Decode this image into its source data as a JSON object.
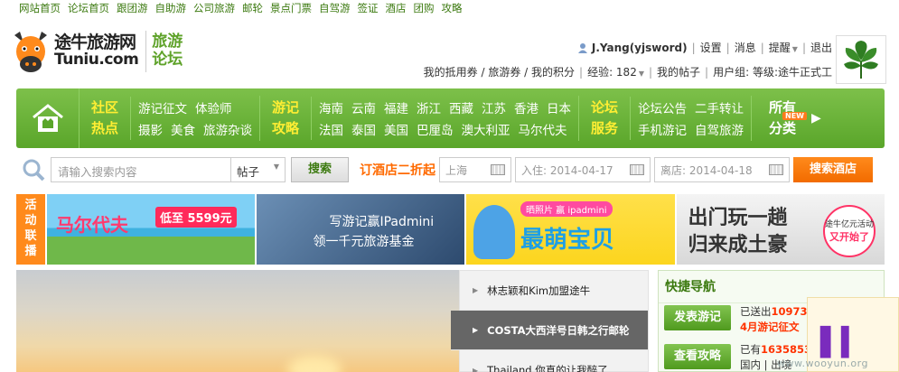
{
  "top_links": [
    "网站首页",
    "论坛首页",
    "跟团游",
    "自助游",
    "公司旅游",
    "邮轮",
    "景点门票",
    "自驾游",
    "签证",
    "酒店",
    "团购",
    "攻略"
  ],
  "logo": {
    "cn": "途牛旅游网",
    "en": "Tuniu.com",
    "forum_line1": "旅游",
    "forum_line2": "论坛"
  },
  "user": {
    "name": "J.Yang(yjsword)",
    "settings": "设置",
    "messages": "消息",
    "reminders": "提醒",
    "logout": "退出",
    "coupons": "我的抵用券 / 旅游券 / 我的积分",
    "exp": "经验: 182",
    "my_posts": "我的帖子",
    "group": "用户组: 等级:途牛正式工"
  },
  "nav": {
    "community_1": "社区",
    "community_2": "热点",
    "community_row1": [
      "游记征文",
      "体验师"
    ],
    "community_row2": [
      "摄影",
      "美食",
      "旅游杂谈"
    ],
    "guides_1": "游记",
    "guides_2": "攻略",
    "guides_row1": [
      "海南",
      "云南",
      "福建",
      "浙江",
      "西藏",
      "江苏",
      "香港",
      "日本"
    ],
    "guides_row2": [
      "法国",
      "泰国",
      "美国",
      "巴厘岛",
      "澳大利亚",
      "马尔代夫"
    ],
    "service_1": "论坛",
    "service_2": "服务",
    "service_row1": [
      "论坛公告",
      "二手转让"
    ],
    "service_row2": [
      "手机游记",
      "自驾旅游"
    ],
    "new_badge": "NEW",
    "all_1": "所有",
    "all_2": "分类"
  },
  "search": {
    "placeholder": "请输入搜索内容",
    "scope": "帖子",
    "button": "搜索",
    "hotel_promo": "订酒店二折起",
    "city": "上海",
    "checkin": "入住: 2014-04-17",
    "checkout": "离店: 2014-04-18",
    "hotel_button": "搜索酒店"
  },
  "ads": {
    "label": [
      "活",
      "动",
      "联",
      "播"
    ],
    "b1_title": "马尔代夫",
    "b1_price": "低至 5599元",
    "b2_line1": "写游记赢IPadmini",
    "b2_line2": "领一千元旅游基金",
    "b3_tag": "晒照片 赢 ipadmini",
    "b3_big": "最萌宝贝",
    "b4_line1": "出门玩一趟",
    "b4_line2": "归来成土豪",
    "b4_circle_top": "途牛亿元活动",
    "b4_circle_main": "又开始了"
  },
  "news": [
    "林志颖和Kim加盟途牛",
    "COSTA大西洋号日韩之行邮轮",
    "Thailand 你真的让我醉了"
  ],
  "quick_nav": {
    "title": "快捷导航",
    "post_btn": "发表游记",
    "post_text_prefix": "已送出",
    "post_count": "10973",
    "post_sub": "4月游记征文",
    "guide_btn": "查看攻略",
    "guide_text_prefix": "已有",
    "guide_count": "1635853",
    "guide_sub": "国内 | 出境"
  },
  "watermark": "www.wooyun.org",
  "colors": {
    "brand_green": "#5aa62a",
    "accent_orange": "#ff6a00",
    "nav_highlight": "#ffee33"
  }
}
